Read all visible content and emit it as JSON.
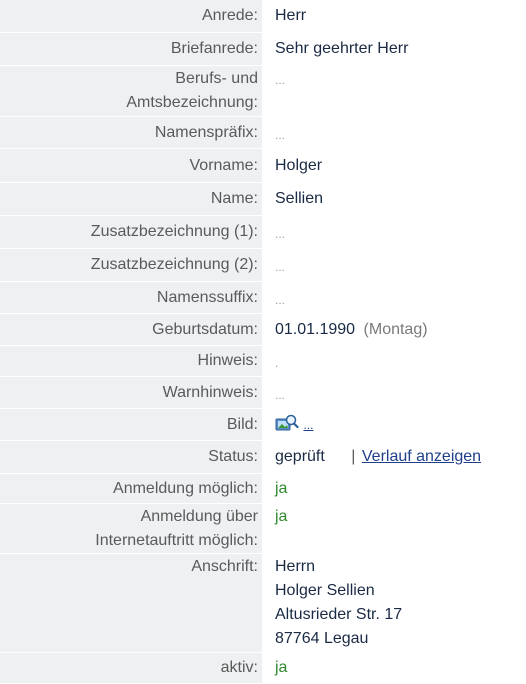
{
  "labels": {
    "anrede": "Anrede:",
    "briefanrede": "Briefanrede:",
    "beruf1": "Berufs- und",
    "beruf2": "Amtsbezeichnung:",
    "namenspraefix": "Namenspräfix:",
    "vorname": "Vorname:",
    "name": "Name:",
    "zusatz1": "Zusatzbezeichnung (1):",
    "zusatz2": "Zusatzbezeichnung (2):",
    "namenssuffix": "Namenssuffix:",
    "geburtsdatum": "Geburtsdatum:",
    "hinweis": "Hinweis:",
    "warnhinweis": "Warnhinweis:",
    "bild": "Bild:",
    "status": "Status:",
    "anmeldung": "Anmeldung möglich:",
    "anm_internet1": "Anmeldung über",
    "anm_internet2": "Internetauftritt möglich:",
    "anschrift": "Anschrift:",
    "aktiv": "aktiv:"
  },
  "values": {
    "anrede": "Herr",
    "briefanrede": "Sehr geehrter Herr",
    "beruf": "...",
    "namenspraefix": "...",
    "vorname": "Holger",
    "name": "Sellien",
    "zusatz1": "...",
    "zusatz2": "...",
    "namenssuffix": "...",
    "geburtsdatum": "01.01.1990",
    "wochentag": "(Montag)",
    "hinweis": ".",
    "warnhinweis": "...",
    "bild_link": "...",
    "status": "geprüft",
    "status_sep": "|",
    "verlauf_link": "Verlauf anzeigen",
    "anmeldung": "ja",
    "anm_internet": "ja",
    "anschrift": [
      "Herrn",
      "Holger Sellien",
      "Altusrieder Str. 17",
      "87764 Legau"
    ],
    "aktiv": "ja"
  },
  "icons": {
    "bild": "picture-search-icon"
  },
  "colors": {
    "label_bg": "#eef0f2",
    "yes": "#2f8a2f",
    "link": "#1f3f8a"
  }
}
